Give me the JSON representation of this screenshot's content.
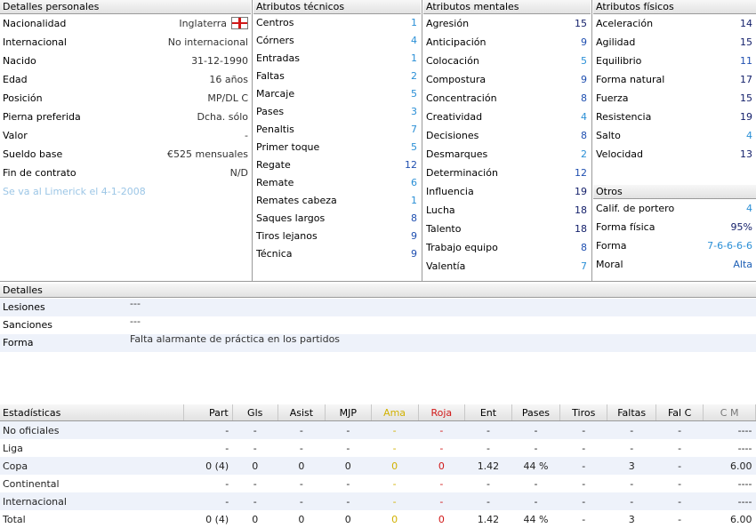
{
  "personal": {
    "header": "Detalles personales",
    "rows": [
      {
        "label": "Nacionalidad",
        "value": "Inglaterra",
        "flag": "england-flag"
      },
      {
        "label": "Internacional",
        "value": "No internacional"
      },
      {
        "label": "Nacido",
        "value": "31-12-1990"
      },
      {
        "label": "Edad",
        "value": "16 años"
      },
      {
        "label": "Posición",
        "value": "MP/DL C"
      },
      {
        "label": "Pierna preferida",
        "value": "Dcha. sólo"
      },
      {
        "label": "Valor",
        "value": "-"
      },
      {
        "label": "Sueldo base",
        "value": "€525 mensuales"
      },
      {
        "label": "Fin de contrato",
        "value": "N/D"
      }
    ],
    "leaving_note": "Se va al Limerick el 4-1-2008"
  },
  "technical": {
    "header": "Atributos técnicos",
    "rows": [
      {
        "label": "Centros",
        "value": "1"
      },
      {
        "label": "Córners",
        "value": "4"
      },
      {
        "label": "Entradas",
        "value": "1"
      },
      {
        "label": "Faltas",
        "value": "2"
      },
      {
        "label": "Marcaje",
        "value": "5"
      },
      {
        "label": "Pases",
        "value": "3"
      },
      {
        "label": "Penaltis",
        "value": "7"
      },
      {
        "label": "Primer toque",
        "value": "5"
      },
      {
        "label": "Regate",
        "value": "12"
      },
      {
        "label": "Remate",
        "value": "6"
      },
      {
        "label": "Remates cabeza",
        "value": "1"
      },
      {
        "label": "Saques largos",
        "value": "8"
      },
      {
        "label": "Tiros lejanos",
        "value": "9"
      },
      {
        "label": "Técnica",
        "value": "9"
      }
    ]
  },
  "mental": {
    "header": "Atributos mentales",
    "rows": [
      {
        "label": "Agresión",
        "value": "15"
      },
      {
        "label": "Anticipación",
        "value": "9"
      },
      {
        "label": "Colocación",
        "value": "5"
      },
      {
        "label": "Compostura",
        "value": "9"
      },
      {
        "label": "Concentración",
        "value": "8"
      },
      {
        "label": "Creatividad",
        "value": "4"
      },
      {
        "label": "Decisiones",
        "value": "8"
      },
      {
        "label": "Desmarques",
        "value": "2"
      },
      {
        "label": "Determinación",
        "value": "12"
      },
      {
        "label": "Influencia",
        "value": "19"
      },
      {
        "label": "Lucha",
        "value": "18"
      },
      {
        "label": "Talento",
        "value": "18"
      },
      {
        "label": "Trabajo equipo",
        "value": "8"
      },
      {
        "label": "Valentía",
        "value": "7"
      }
    ]
  },
  "physical": {
    "header": "Atributos físicos",
    "rows": [
      {
        "label": "Aceleración",
        "value": "14"
      },
      {
        "label": "Agilidad",
        "value": "15"
      },
      {
        "label": "Equilibrio",
        "value": "11"
      },
      {
        "label": "Forma natural",
        "value": "17"
      },
      {
        "label": "Fuerza",
        "value": "15"
      },
      {
        "label": "Resistencia",
        "value": "19"
      },
      {
        "label": "Salto",
        "value": "4"
      },
      {
        "label": "Velocidad",
        "value": "13"
      }
    ]
  },
  "other": {
    "header": "Otros",
    "rows": [
      {
        "label": "Calif. de portero",
        "value": "4"
      },
      {
        "label": "Forma física",
        "value": "95%"
      },
      {
        "label": "Forma",
        "value": "7-6-6-6-6"
      },
      {
        "label": "Moral",
        "value": "Alta"
      }
    ]
  },
  "details": {
    "header": "Detalles",
    "rows": [
      {
        "label": "Lesiones",
        "value": "---"
      },
      {
        "label": "Sanciones",
        "value": "---"
      },
      {
        "label": "Forma",
        "value": "Falta alarmante de práctica en los partidos"
      }
    ]
  },
  "stats": {
    "columns": [
      "Estadísticas",
      "Part",
      "Gls",
      "Asist",
      "MJP",
      "Ama",
      "Roja",
      "Ent",
      "Pases",
      "Tiros",
      "Faltas",
      "Fal C",
      "C M"
    ],
    "rows": [
      [
        "No oficiales",
        "-",
        "-",
        "-",
        "-",
        "-",
        "-",
        "-",
        "-",
        "-",
        "-",
        "-",
        "----"
      ],
      [
        "Liga",
        "-",
        "-",
        "-",
        "-",
        "-",
        "-",
        "-",
        "-",
        "-",
        "-",
        "-",
        "----"
      ],
      [
        "Copa",
        "0 (4)",
        "0",
        "0",
        "0",
        "0",
        "0",
        "1.42",
        "44 %",
        "-",
        "3",
        "-",
        "6.00"
      ],
      [
        "Continental",
        "-",
        "-",
        "-",
        "-",
        "-",
        "-",
        "-",
        "-",
        "-",
        "-",
        "-",
        "----"
      ],
      [
        "Internacional",
        "-",
        "-",
        "-",
        "-",
        "-",
        "-",
        "-",
        "-",
        "-",
        "-",
        "-",
        "----"
      ],
      [
        "Total",
        "0 (4)",
        "0",
        "0",
        "0",
        "0",
        "0",
        "1.42",
        "44 %",
        "-",
        "3",
        "-",
        "6.00"
      ]
    ]
  },
  "colors": {
    "attr_low": "#2a8fd6",
    "attr_mid": "#1f4fb0",
    "attr_high": "#14206b",
    "yellow_cards": "#d1b100",
    "red_cards": "#d01818"
  }
}
